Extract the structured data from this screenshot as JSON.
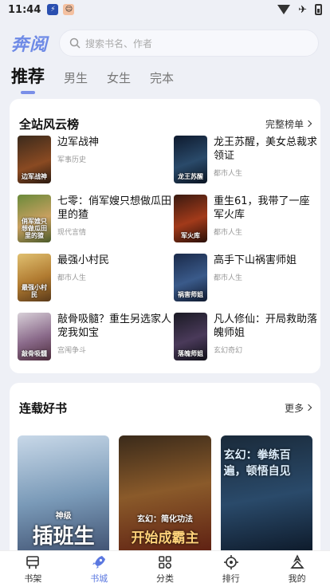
{
  "status_bar": {
    "time": "11:44"
  },
  "header": {
    "logo": "奔阅",
    "search_placeholder": "搜索书名、作者"
  },
  "tabs": [
    {
      "label": "推荐",
      "active": true
    },
    {
      "label": "男生",
      "active": false
    },
    {
      "label": "女生",
      "active": false
    },
    {
      "label": "完本",
      "active": false
    }
  ],
  "ranking": {
    "title": "全站风云榜",
    "more_label": "完整榜单",
    "items": [
      {
        "name": "边军战神",
        "tag": "军事历史",
        "cover_text": "边军战神"
      },
      {
        "name": "龙王苏醒，美女总裁求领证",
        "tag": "都市人生",
        "cover_text": "龙王苏醒"
      },
      {
        "name": "七零：俏军嫂只想做瓜田里的猹",
        "tag": "现代言情",
        "cover_text": "俏军嫂只想做瓜田里的猹"
      },
      {
        "name": "重生61，我带了一座军火库",
        "tag": "都市人生",
        "cover_text": "军火库"
      },
      {
        "name": "最强小村民",
        "tag": "都市人生",
        "cover_text": "最强小村民"
      },
      {
        "name": "高手下山祸害师姐",
        "tag": "都市人生",
        "cover_text": "祸害师姐"
      },
      {
        "name": "敲骨吸髓？重生另选家人宠我如宝",
        "tag": "宫闱争斗",
        "cover_text": "敲骨吸髓"
      },
      {
        "name": "凡人修仙：开局救助落魄师姐",
        "tag": "玄幻奇幻",
        "cover_text": "落魄师姐"
      }
    ]
  },
  "serial": {
    "title": "连载好书",
    "more_label": "更多",
    "books": [
      {
        "cover_text": "插班生",
        "sub_text": "神级"
      },
      {
        "cover_text": "开始成霸主",
        "sub_text": "玄幻：简化功法"
      },
      {
        "cover_text": "玄幻：拳练百遍，顿悟自见",
        "sub_text": ""
      }
    ]
  },
  "bottom_nav": [
    {
      "label": "书架",
      "icon": "bookshelf-icon",
      "active": false
    },
    {
      "label": "书城",
      "icon": "rocket-icon",
      "active": true
    },
    {
      "label": "分类",
      "icon": "category-icon",
      "active": false
    },
    {
      "label": "排行",
      "icon": "ranking-icon",
      "active": false
    },
    {
      "label": "我的",
      "icon": "profile-icon",
      "active": false
    }
  ],
  "colors": {
    "accent": "#5b78e0",
    "logo": "#6e8ae6",
    "background": "#eef0f6"
  }
}
